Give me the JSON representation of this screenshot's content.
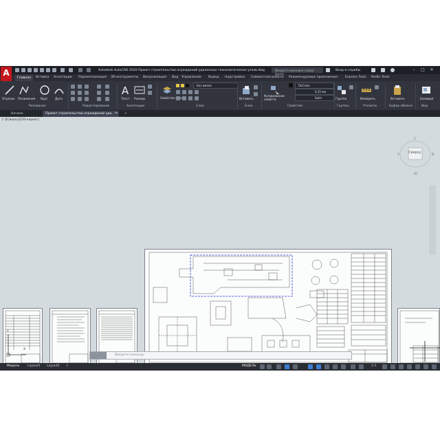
{
  "app": {
    "logo_letter": "A",
    "title": "Autodesk AutoCAD 2020   Проект строительства ограждений удаленных технологических узлов.dwg",
    "search_placeholder": "Введите ключевое слово/фразу",
    "user": "Вход в службы",
    "window_buttons": [
      "–",
      "□",
      "✕"
    ]
  },
  "ribbon_tabs": [
    {
      "label": "Главная",
      "active": true
    },
    {
      "label": "Вставка"
    },
    {
      "label": "Аннотации"
    },
    {
      "label": "Параметризация"
    },
    {
      "label": "3D-инструменты"
    },
    {
      "label": "Визуализация"
    },
    {
      "label": "Вид"
    },
    {
      "label": "Управление"
    },
    {
      "label": "Вывод"
    },
    {
      "label": "Надстройки"
    },
    {
      "label": "Совместная работа"
    },
    {
      "label": "Рекомендуемые приложения"
    },
    {
      "label": "Express Tools"
    },
    {
      "label": "Redbr Tools"
    }
  ],
  "ribbon": {
    "draw_tools": [
      "Отрезок",
      "Полилиния",
      "Круг",
      "Дуга"
    ],
    "draw_group": "Рисование",
    "modify_group": "Редактирование",
    "text_tools": [
      "Текст",
      "Размер"
    ],
    "annotation_group": "Аннотации",
    "layer_props": "Свойства слоя",
    "layer_value": "Без имени",
    "layers_group": "Слои",
    "insert_label": "Вставить",
    "block_group": "Блок",
    "match_props": "Копирование свойств",
    "color_value": "ПоСлою",
    "lineweight_value": "0,25 мм",
    "linetype_value": "Solid",
    "properties_group": "Свойства",
    "group_label": "Группа",
    "groups_group": "Группы",
    "measure_label": "Измерить",
    "utilities_group": "Утилиты",
    "paste_label": "Вставить",
    "clipboard_group": "Буфер обмена",
    "base_label": "Базовый",
    "view_group": "Вид"
  },
  "doc_tabs": [
    {
      "label": "Начало"
    },
    {
      "label": "Проект строительства ограждений уда...*",
      "active": true
    }
  ],
  "viewport": {
    "label": "[–][Сверху][2D-каркас]",
    "viewcube_face": "Сверху",
    "viewcube_compass": [
      "С",
      "Ю",
      "З",
      "В"
    ],
    "ucs_y": "Y",
    "ucs_x": "X"
  },
  "command": {
    "placeholder": "Введите команду"
  },
  "status": {
    "tabs": [
      {
        "label": "Модель",
        "active": true
      },
      {
        "label": "Layout1"
      },
      {
        "label": "Layout2"
      }
    ],
    "add_tab": "+",
    "mode": "МОДЕЛЬ",
    "scale": "1:1"
  },
  "colors": {
    "title_bg": "#1e2027",
    "ribbon_bg": "#32353e",
    "canvas_bg": "#d4dbdf",
    "selection": "#2233cc",
    "accent": "#3c7dd1"
  }
}
